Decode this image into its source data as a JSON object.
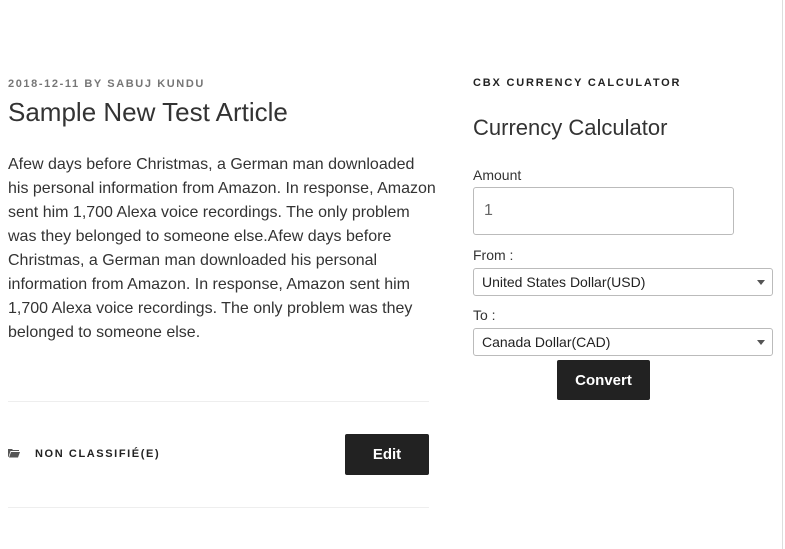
{
  "article": {
    "date": "2018-12-11",
    "by_label": "BY",
    "author": "SABUJ KUNDU",
    "title": "Sample New Test Article",
    "body": "Afew days before Christmas, a German man downloaded his personal information from Amazon. In response, Amazon sent him 1,700 Alexa voice recordings. The only problem was they belonged to someone else.Afew days before Christmas, a German man downloaded his personal information from Amazon. In response, Amazon sent him 1,700 Alexa voice recordings. The only problem was they belonged to someone else.",
    "category": "NON CLASSIFIÉ(E)",
    "category_icon": "folder-icon",
    "edit_label": "Edit"
  },
  "widget": {
    "title": "CBX CURRENCY CALCULATOR",
    "heading": "Currency Calculator",
    "amount_label": "Amount",
    "amount_value": "1",
    "from_label": "From :",
    "from_value": "United States Dollar(USD)",
    "to_label": "To :",
    "to_value": "Canada Dollar(CAD)",
    "convert_label": "Convert"
  },
  "colors": {
    "button_bg": "#222222",
    "meta_text": "#767676",
    "rule": "#eeeeee"
  }
}
